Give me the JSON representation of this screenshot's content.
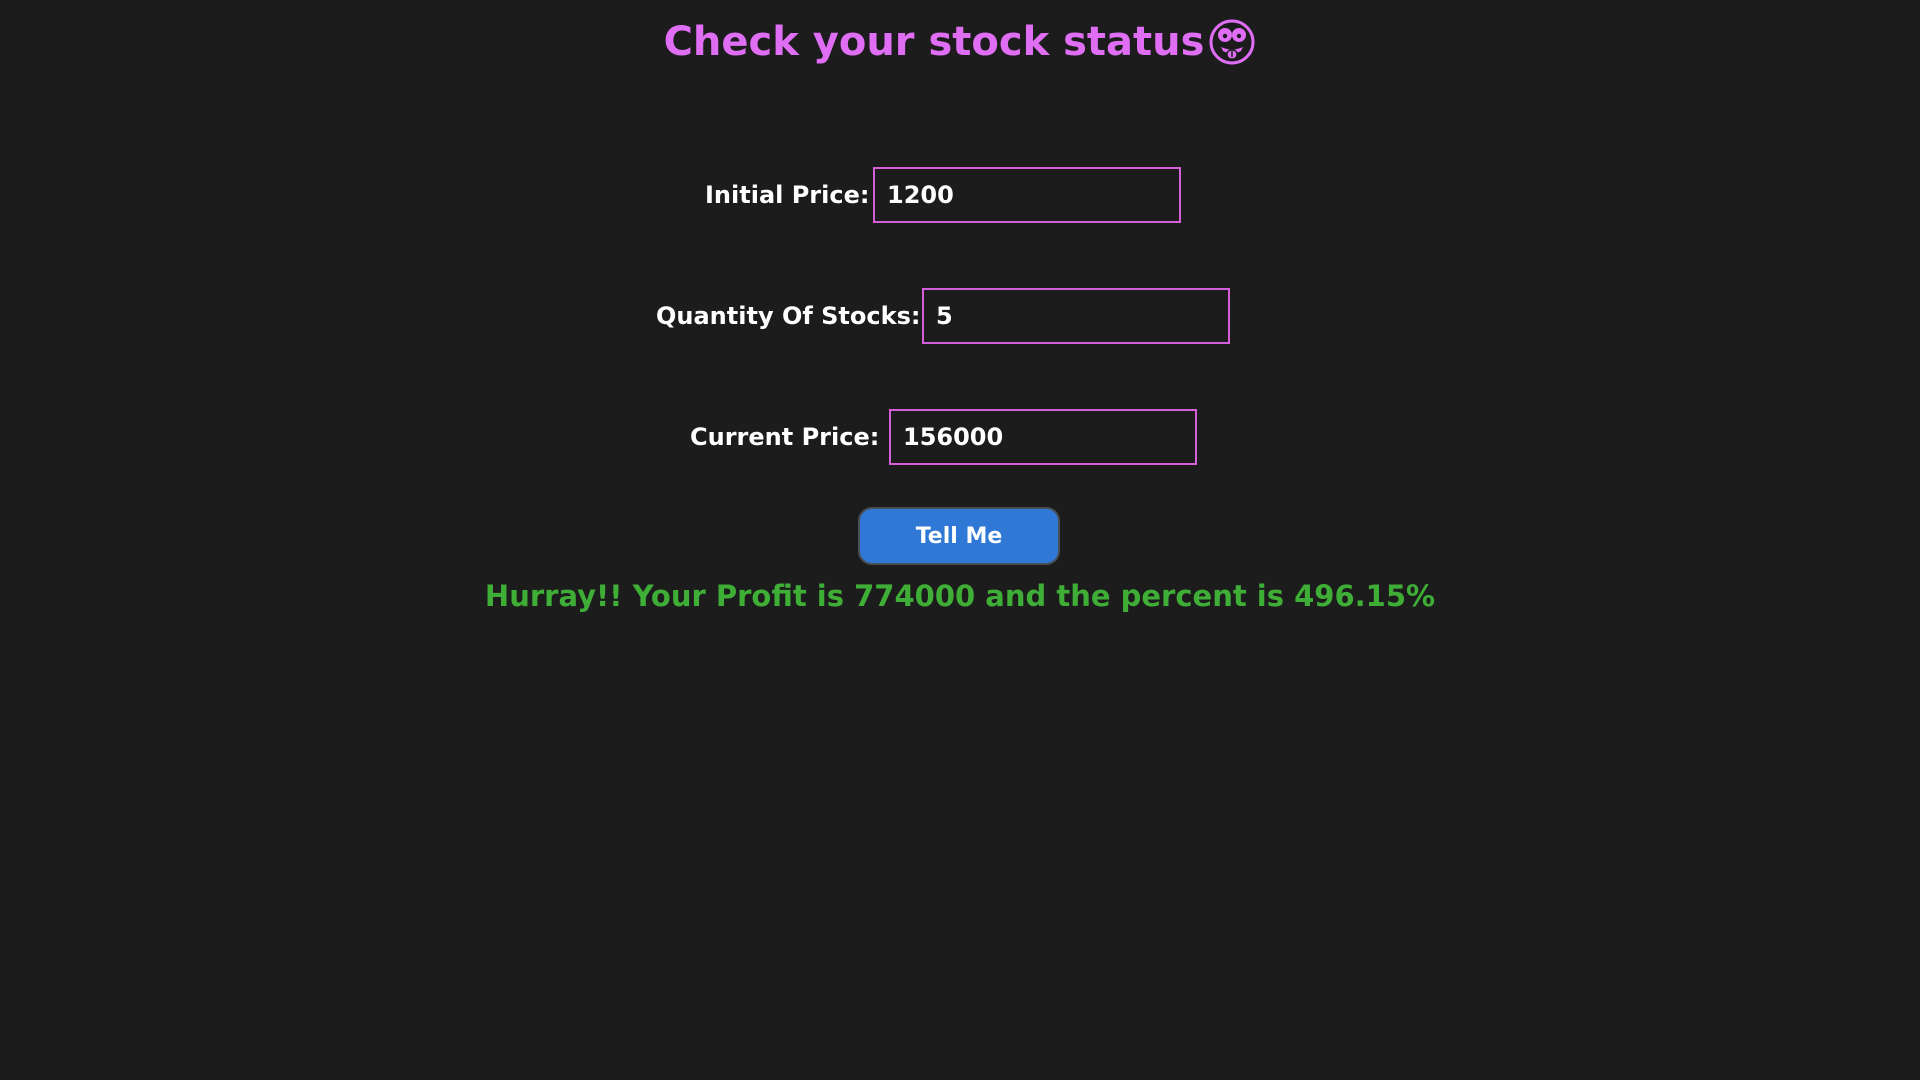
{
  "header": {
    "title": "Check your stock status",
    "icon": "tongue-out-face-icon",
    "title_color": "#e06ef5"
  },
  "form": {
    "initial_price": {
      "label": "Initial Price:",
      "value": "1200"
    },
    "quantity": {
      "label": "Quantity Of Stocks:",
      "value": "5"
    },
    "current_price": {
      "label": "Current Price:",
      "value": "156000"
    },
    "submit_label": "Tell Me"
  },
  "result": {
    "text": "Hurray!! Your Profit is 774000 and the percent is 496.15%",
    "color": "#3fae36"
  },
  "colors": {
    "background": "#1c1c1c",
    "input_border": "#d45fd8",
    "button": "#2f78d6"
  }
}
